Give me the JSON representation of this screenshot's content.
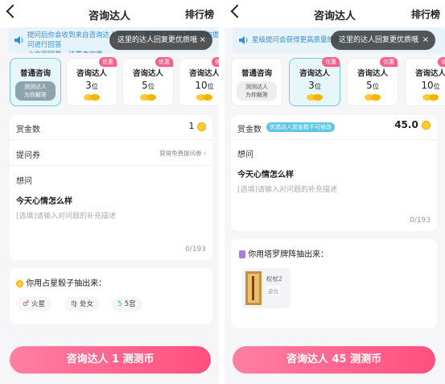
{
  "left": {
    "title": "咨询达人",
    "rank": "排行榜",
    "notice": "提问后你会收到来自咨询达人的回复，咨询达人将会根据你的提问进行回答\n上文字回复，注意查收哦",
    "tip": "这里的达人回复更优质哦",
    "tip_close": "×",
    "options": [
      {
        "label": "普通咨询",
        "sub": "测测达人\n为你解答",
        "selected": true
      },
      {
        "label": "咨询达人",
        "badge": "优惠",
        "count": "3",
        "unit": "位"
      },
      {
        "label": "咨询达人",
        "badge": "优惠",
        "count": "5",
        "unit": "位"
      },
      {
        "label": "咨询达人",
        "badge": "优惠",
        "count": "10",
        "unit": "位"
      }
    ],
    "reward_label": "赏金数",
    "reward_value": "1",
    "coupon_label": "提问券",
    "coupon_hint": "获得免费提问券",
    "coupon_arrow": "›",
    "ask_label": "想问",
    "question": "今天心情怎么样",
    "placeholder": "[选填]请输入对问题的补充描述",
    "counter": "0/193",
    "dice_title": "你用占星骰子抽出来：",
    "dice": [
      {
        "icon": "♂",
        "label": "火星",
        "color": "#e0463a"
      },
      {
        "icon": "♍",
        "label": "处女",
        "color": "#a0522d"
      },
      {
        "icon": "5",
        "label": "5宫",
        "color": "#35b5d6"
      }
    ],
    "button": "咨询达人 1 测测币"
  },
  "right": {
    "title": "咨询达人",
    "rank": "排行榜",
    "notice": "星级提问会获得更高质量的回复",
    "tip": "这里的达人回复更优质哦",
    "tip_close": "×",
    "options": [
      {
        "label": "普通咨询",
        "sub": "测测达人\n为你解答"
      },
      {
        "label": "咨询达人",
        "badge": "优惠",
        "count": "3",
        "unit": "位",
        "selected": true
      },
      {
        "label": "咨询达人",
        "badge": "优惠",
        "count": "5",
        "unit": "位"
      },
      {
        "label": "咨询达人",
        "badge": "优惠",
        "count": "10",
        "unit": "位"
      }
    ],
    "reward_label": "赏金数",
    "reward_tag": "优选达人赏金数不可修改",
    "reward_value": "45.0",
    "ask_label": "想问",
    "question": "今天心情怎么样",
    "placeholder": "[选填]请输入对问题的补充描述",
    "counter": "0/193",
    "tarot_title": "你用塔罗牌阵抽出来：",
    "tarot_card_name": "权杖2",
    "tarot_card_pos": "逆位",
    "button": "咨询达人 45 测测币"
  },
  "colors": {
    "accent": "#ff4f7f",
    "teal": "#6fcfda",
    "badge": "#ff5f87",
    "notice": "#3a8fd0"
  }
}
